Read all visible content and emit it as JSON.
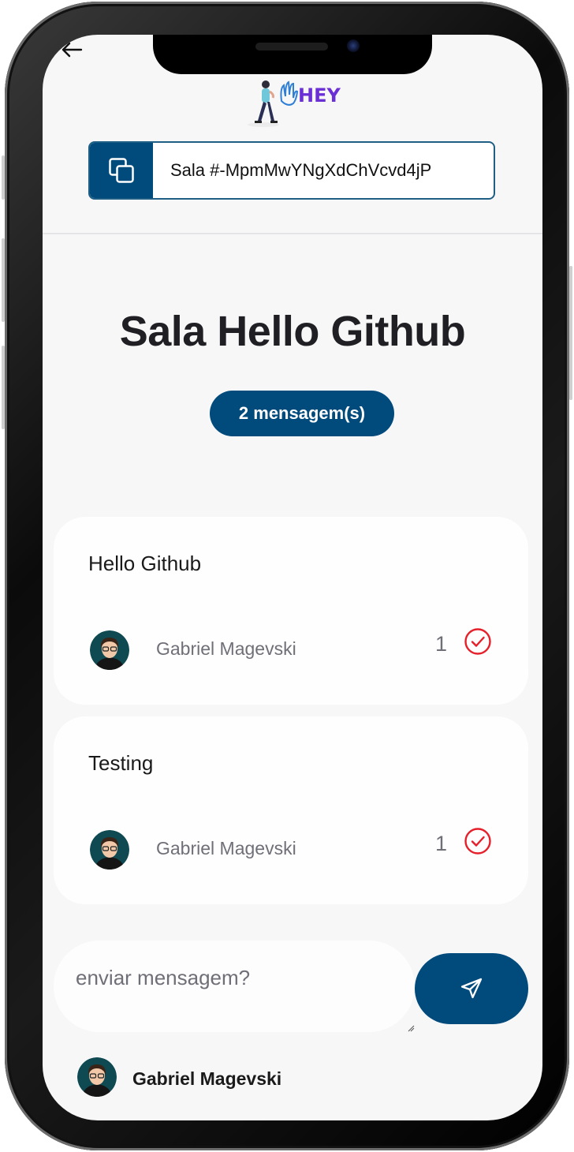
{
  "header": {
    "back_icon": "arrow-left-icon",
    "logo_text": "HEY",
    "copy_icon": "copy-icon",
    "room_code": "Sala #-MpmMwYNgXdChVcvd4jP"
  },
  "room": {
    "title": "Sala Hello Github",
    "message_count": "2 mensagem(s)"
  },
  "questions": [
    {
      "text": "Hello Github",
      "author": "Gabriel Magevski",
      "likes": "1",
      "like_icon": "check-circle-icon"
    },
    {
      "text": "Testing",
      "author": "Gabriel Magevski",
      "likes": "1",
      "like_icon": "check-circle-icon"
    }
  ],
  "composer": {
    "placeholder": "enviar mensagem?",
    "send_icon": "send-icon"
  },
  "user": {
    "name": "Gabriel Magevski"
  },
  "colors": {
    "primary": "#004a7c",
    "accent_red": "#e5202a",
    "logo_purple": "#6b2fd6",
    "background": "#f7f7f8"
  }
}
